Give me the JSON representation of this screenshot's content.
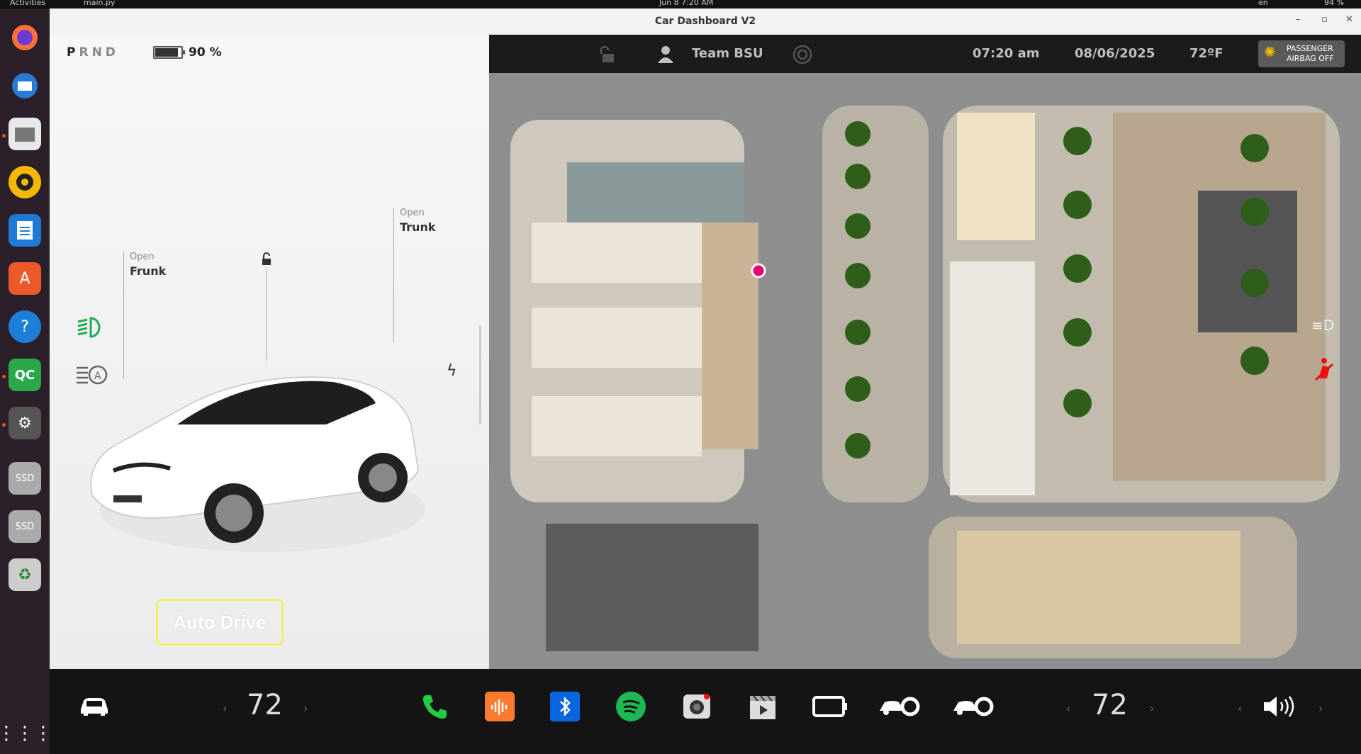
{
  "topbar": {
    "activities": "Activities",
    "app_menu": "main.py",
    "clock": "Jun 8  7:20 AM",
    "lang": "en",
    "status": "94 %"
  },
  "window": {
    "title": "Car Dashboard V2"
  },
  "left_panel": {
    "gear": {
      "p": "P",
      "r": "R",
      "n": "N",
      "d": "D"
    },
    "battery": {
      "percent": 90,
      "label": "90 %"
    },
    "frunk": {
      "state": "Open",
      "name": "Frunk"
    },
    "trunk": {
      "state": "Open",
      "name": "Trunk"
    },
    "auto_drive_label": "Auto Drive"
  },
  "map_bar": {
    "team": "Team BSU",
    "time": "07:20 am",
    "date": "08/06/2025",
    "temperature": "72ºF",
    "airbag_line1": "PASSENGER",
    "airbag_line2": "AIRBAG OFF"
  },
  "bottom_bar": {
    "left_temp": "72",
    "right_temp": "72",
    "left_chevron": "‹",
    "right_chevron": "›"
  },
  "colors": {
    "auto_drive_border": "#f0ef6a",
    "headlight": "#22aa55",
    "phone": "#22cc44",
    "spotify": "#1db954",
    "bluetooth": "#0a66e0",
    "audio": "#ff7a2e"
  },
  "icons": [
    "car-icon",
    "phone-icon",
    "audio-icon",
    "bluetooth-icon",
    "spotify-icon",
    "camera-icon",
    "video-icon",
    "screen-icon",
    "car-settings-icon",
    "volume-icon"
  ]
}
